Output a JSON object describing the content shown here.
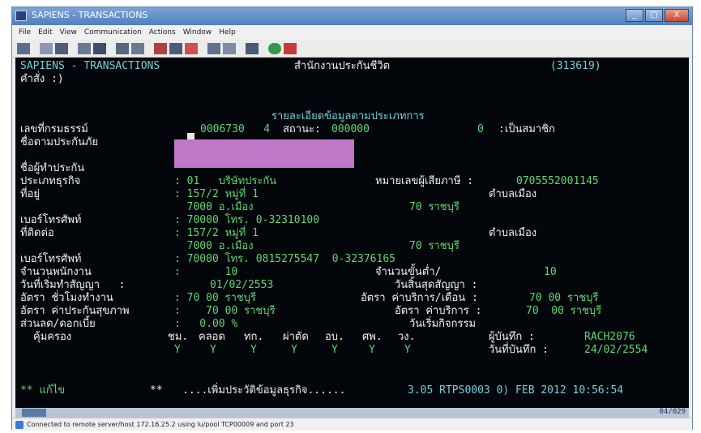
{
  "window": {
    "title": "SAPIENS - TRANSACTIONS",
    "controls": {
      "minimize": "_",
      "maximize": "□",
      "close": "X"
    }
  },
  "menu": [
    "File",
    "Edit",
    "View",
    "Communication",
    "Actions",
    "Window",
    "Help"
  ],
  "toolbar_icons": [
    "open-icon",
    "save-icon",
    "copy-icon",
    "paste-icon",
    "print-icon",
    "send-icon",
    "receive-icon",
    "grid-icon",
    "screen-icon",
    "macro-icon",
    "record-icon",
    "play-icon",
    "help-icon",
    "color-icon",
    "settings-icon"
  ],
  "terminal": {
    "header_left": "SAPIENS - TRANSACTIONS",
    "header_center": "สำนักงานประกันชีวิต",
    "header_right": "(313619)",
    "prompt": "คำสั่ง :)",
    "form_title": "รายละเอียดข้อมูลตามประเภทการ",
    "policy_no_label": "เลขที่กรมธรรม์",
    "policy_no_value": "0006730   4",
    "status_label": "สถานะ:",
    "status_value": "000000",
    "status_code": "0",
    "status_text": ":เป็นสมาชิก",
    "plan_label": "ชื่อตามประกันภัย",
    "insured_label": "ชื่อผู้ทำประกัน",
    "type_label": "ประเภทธุรกิจ",
    "type_value": ": 01   บริษัทประกัน",
    "tax_label": "หมายเลขผู้เสียภาษี :",
    "tax_value": "0705552001145",
    "address1_label": "ที่อยู่",
    "address1_line1": ": 157/2 หมู่ที่ 1",
    "address1_district": "ตำบลเมือง",
    "address1_line2": "  7000 อ.เมือง",
    "address1_province": "70 ราชบุรี",
    "phone1_label": "เบอร์โทรศัพท์",
    "phone1_value": ": 70000 โทร. 0-32310100",
    "address2_label": "ที่ติดต่อ",
    "address2_line1": ": 157/2 หมู่ที่ 1",
    "address2_district": "ตำบลเมือง",
    "address2_line2": "  7000 อ.เมือง",
    "address2_province": "70 ราชบุรี",
    "phone2_label": "เบอร์โทรศัพท์",
    "phone2_value": ": 70000 โทร. 0815275547  0-32376165",
    "count_label": "จำนวนพนักงาน",
    "count_value": ":       10",
    "min_label": "จำนวนขั้นต่ำ/",
    "min_value": "10",
    "start_label": "วันที่เริ่มทำสัญญา   :",
    "start_value": "01/02/2553",
    "end_label": "วันสิ้นสุดสัญญา :",
    "rate1_label": "อัตรา ชั่วโมงทำงาน",
    "rate1_value": ": 70 00 ราชบุรี",
    "rate1b_label": "อัตรา ค่าบริการ/เดือน :",
    "rate1b_value": "70 00 ราชบุรี",
    "rate2_label": "อัตรา ค่าประกันสุขภาพ",
    "rate2_value": ":    70 00 ราชบุรี",
    "rate2b_label": "อัตรา ค่าบริการ :",
    "rate2b_value": "70  00 ราชบุรี",
    "discount_label": "ส่วนลด/ดอกเบี้ย",
    "discount_value": ":   0.00 %",
    "other_label": "วันเริ่มกิจกรรม",
    "flags_label": "คุ้มครอง",
    "flag_headers": [
      "ชม.",
      "คลอด",
      "ทก.",
      "ผ่าตัด",
      "อบ.",
      "ศพ.",
      "วง."
    ],
    "flag_values": [
      "Y",
      "Y",
      "Y",
      "Y",
      "Y",
      "Y",
      "Y"
    ],
    "user_label": "ผู้บันทึก :",
    "user_value": "RACH2076",
    "date_label": "วันที่บันทึก :",
    "date_value": "24/02/2554",
    "footer_left": "** แก้ไข",
    "footer_dots": "**",
    "footer_msg": "....เพิ่มประวัติข้อมูลธุรกิจ......",
    "footer_right": "3.05 RTPS0003 0) FEB 2012 10:56:54"
  },
  "scroll_position": "04/029",
  "status_text": "Connected to remote server/host 172.16.25.2 using lu/pool TCP00009 and port 23"
}
